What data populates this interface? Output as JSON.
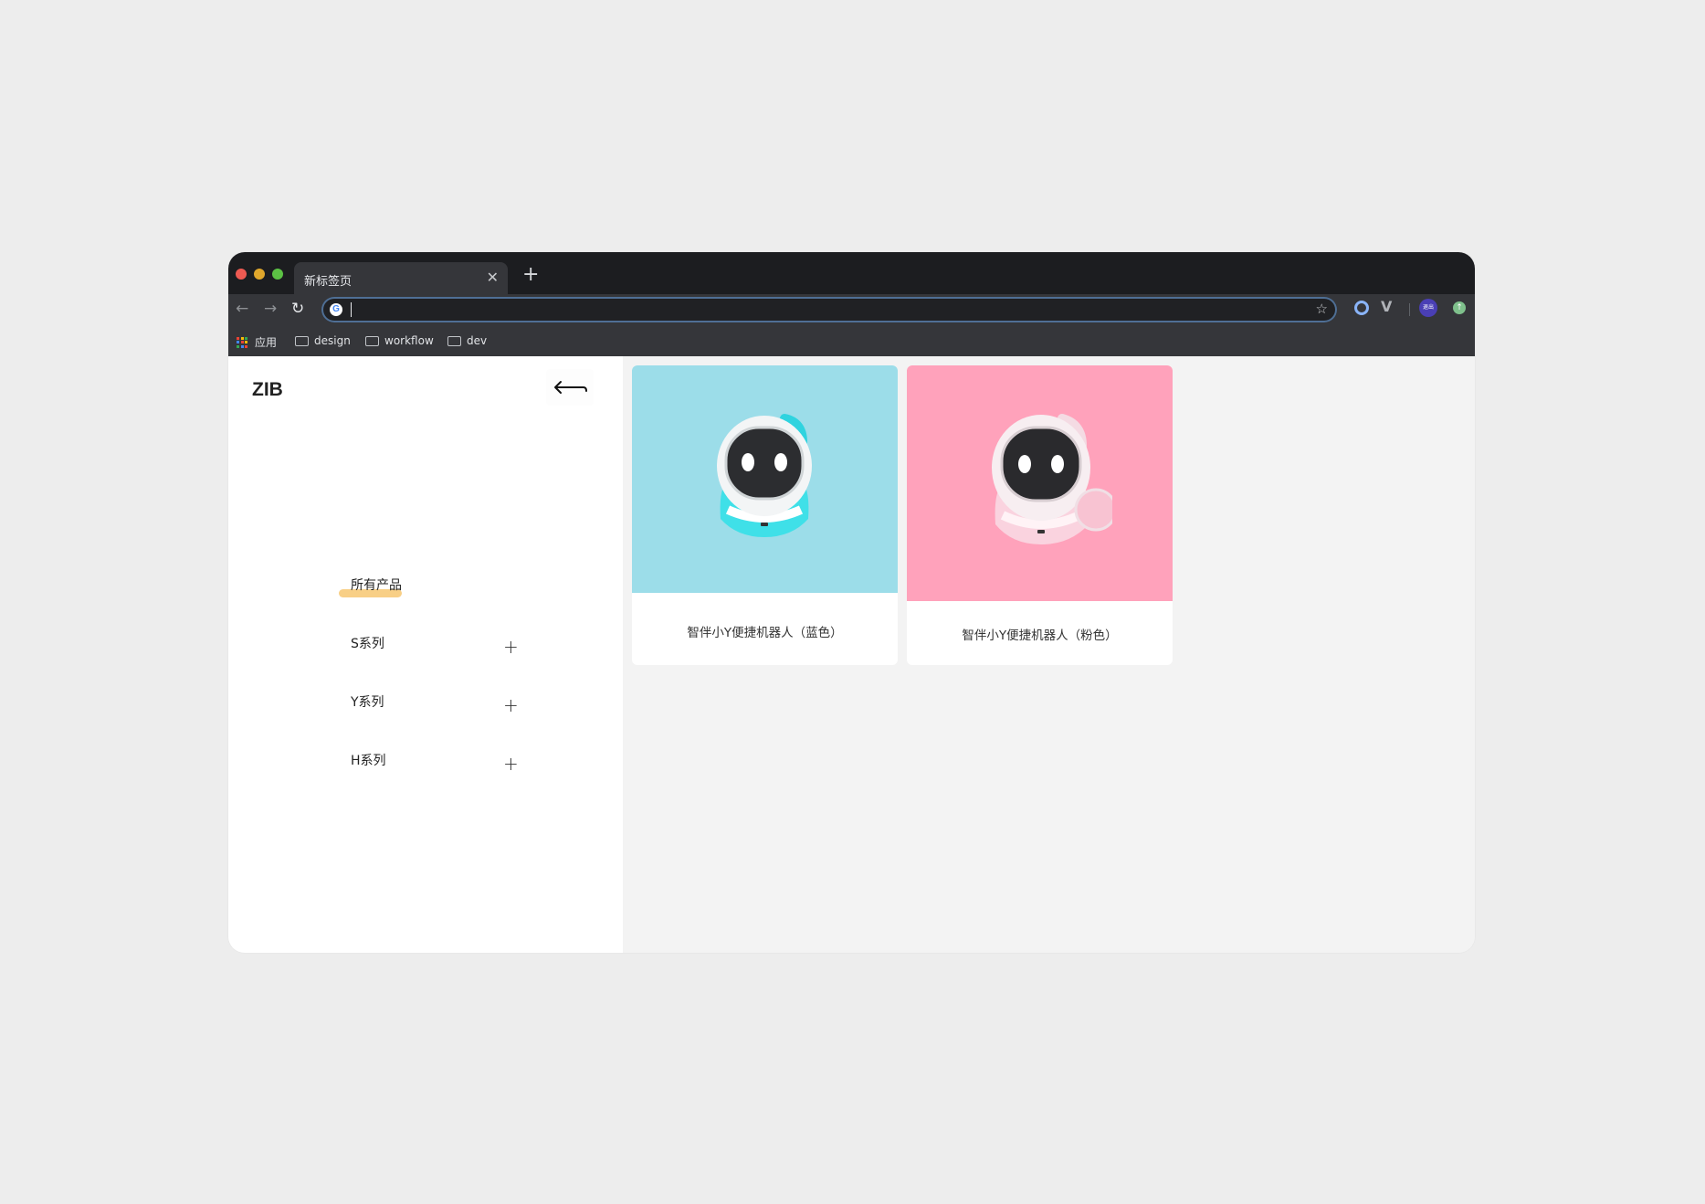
{
  "browser": {
    "tab_title": "新标签页",
    "tab_close": "✕",
    "new_tab": "+",
    "omnibox_value": "",
    "avatar_label": "退出",
    "bookmarks": {
      "apps": "应用",
      "items": [
        "design",
        "workflow",
        "dev"
      ]
    }
  },
  "sidebar": {
    "logo": "ZIB",
    "menu": {
      "active": "所有产品",
      "items": [
        "S系列",
        "Y系列",
        "H系列"
      ],
      "expand_glyph": "+"
    }
  },
  "products": [
    {
      "name": "智伴小Y便捷机器人（蓝色）",
      "color": "#9cdde9",
      "accent": "#3fe0e8"
    },
    {
      "name": "智伴小Y便捷机器人（粉色）",
      "color": "#ffa2bb",
      "accent": "#f6cfdc"
    }
  ],
  "icons": {
    "back": "back-arrow-icon",
    "reload": "reload-icon",
    "star": "bookmark-star-icon",
    "folder": "folder-icon",
    "plus": "plus-icon"
  }
}
